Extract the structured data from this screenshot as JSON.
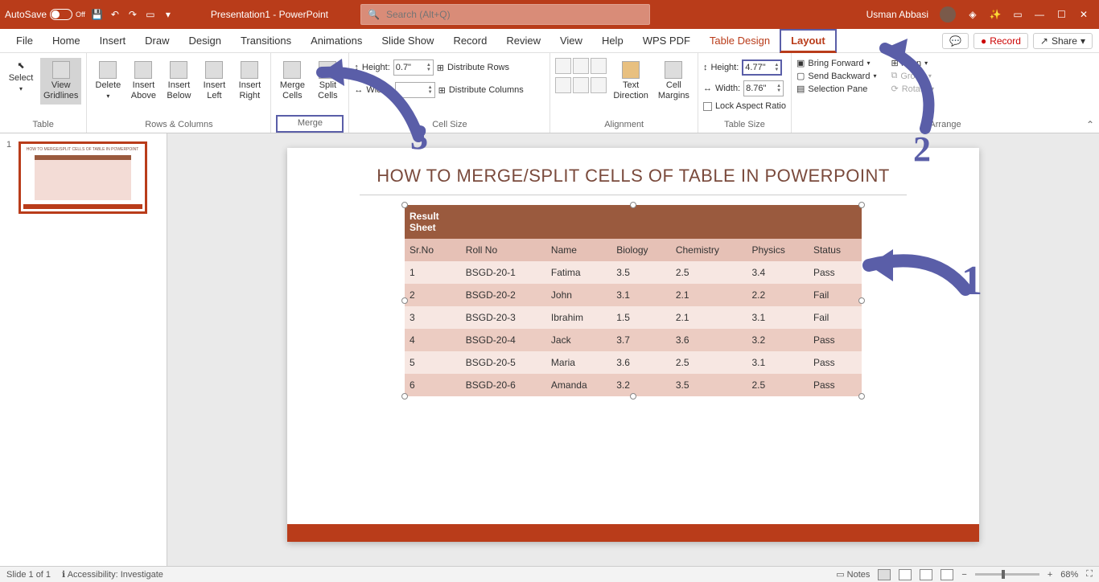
{
  "titlebar": {
    "autosave_label": "AutoSave",
    "autosave_off": "Off",
    "doc_title": "Presentation1 - PowerPoint",
    "search_placeholder": "Search (Alt+Q)",
    "user_name": "Usman Abbasi"
  },
  "menu": {
    "items": [
      "File",
      "Home",
      "Insert",
      "Draw",
      "Design",
      "Transitions",
      "Animations",
      "Slide Show",
      "Record",
      "Review",
      "View",
      "Help",
      "WPS PDF",
      "Table Design",
      "Layout"
    ],
    "comments_btn": "",
    "record_btn": "Record",
    "share_btn": "Share"
  },
  "ribbon": {
    "table": {
      "select": "Select",
      "view_grid": "View\nGridlines",
      "label": "Table"
    },
    "rows_cols": {
      "delete": "Delete",
      "above": "Insert\nAbove",
      "below": "Insert\nBelow",
      "left": "Insert\nLeft",
      "right": "Insert\nRight",
      "label": "Rows & Columns"
    },
    "merge": {
      "merge": "Merge\nCells",
      "split": "Split\nCells",
      "label": "Merge"
    },
    "cell_size": {
      "height_lbl": "Height:",
      "height_val": "0.7\"",
      "width_lbl": "Width:",
      "width_val": "",
      "dist_rows": "Distribute Rows",
      "dist_cols": "Distribute Columns",
      "label": "Cell Size"
    },
    "alignment": {
      "text_dir": "Text\nDirection",
      "cell_marg": "Cell\nMargins",
      "label": "Alignment"
    },
    "table_size": {
      "height_lbl": "Height:",
      "height_val": "4.77\"",
      "width_lbl": "Width:",
      "width_val": "8.76\"",
      "lock": "Lock Aspect Ratio",
      "label": "Table Size"
    },
    "arrange": {
      "fwd": "Bring Forward",
      "back": "Send Backward",
      "sel": "Selection Pane",
      "align": "Align",
      "group": "Group",
      "rotate": "Rotate",
      "label": "Arrange"
    }
  },
  "thumbs": {
    "num": "1"
  },
  "slide": {
    "title": "HOW TO MERGE/SPLIT CELLS OF TABLE IN POWERPOINT",
    "header_cell": "Result\nSheet",
    "columns": [
      "Sr.No",
      "Roll No",
      "Name",
      "Biology",
      "Chemistry",
      "Physics",
      "Status"
    ],
    "rows": [
      [
        "1",
        "BSGD-20-1",
        "Fatima",
        "3.5",
        "2.5",
        "3.4",
        "Pass"
      ],
      [
        "2",
        "BSGD-20-2",
        "John",
        "3.1",
        "2.1",
        "2.2",
        "Fail"
      ],
      [
        "3",
        "BSGD-20-3",
        "Ibrahim",
        "1.5",
        "2.1",
        "3.1",
        "Fail"
      ],
      [
        "4",
        "BSGD-20-4",
        "Jack",
        "3.7",
        "3.6",
        "3.2",
        "Pass"
      ],
      [
        "5",
        "BSGD-20-5",
        "Maria",
        "3.6",
        "2.5",
        "3.1",
        "Pass"
      ],
      [
        "6",
        "BSGD-20-6",
        "Amanda",
        "3.2",
        "3.5",
        "2.5",
        "Pass"
      ]
    ]
  },
  "annotations": {
    "n1": "1",
    "n2": "2",
    "n3": "3"
  },
  "status": {
    "slide": "Slide 1 of 1",
    "access": "Accessibility: Investigate",
    "notes": "Notes",
    "zoom": "68%"
  }
}
